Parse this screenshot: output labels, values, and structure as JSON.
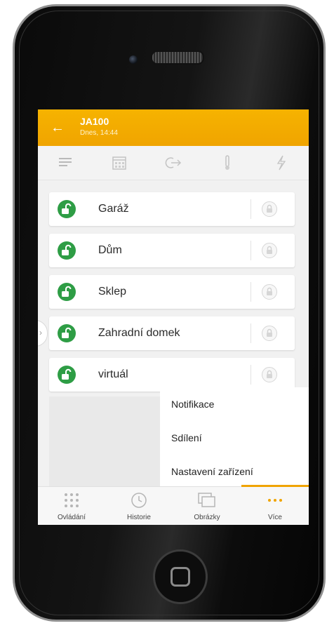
{
  "header": {
    "back_glyph": "←",
    "title": "JA100",
    "subtitle": "Dnes, 14:44"
  },
  "filters": [
    "list-icon",
    "calendar-icon",
    "exit-icon",
    "thermometer-icon",
    "lightning-icon"
  ],
  "devices": [
    {
      "label": "Garáž"
    },
    {
      "label": "Dům"
    },
    {
      "label": "Sklep"
    },
    {
      "label": "Zahradní domek"
    },
    {
      "label": "virtuál"
    }
  ],
  "menu": {
    "items": [
      "Notifikace",
      "Sdílení",
      "Nastavení zařízení"
    ]
  },
  "tabs": [
    {
      "label": "Ovládání"
    },
    {
      "label": "Historie"
    },
    {
      "label": "Obrázky"
    },
    {
      "label": "Více"
    }
  ],
  "colors": {
    "accent": "#f0a400",
    "lock_green": "#2e9d45"
  }
}
